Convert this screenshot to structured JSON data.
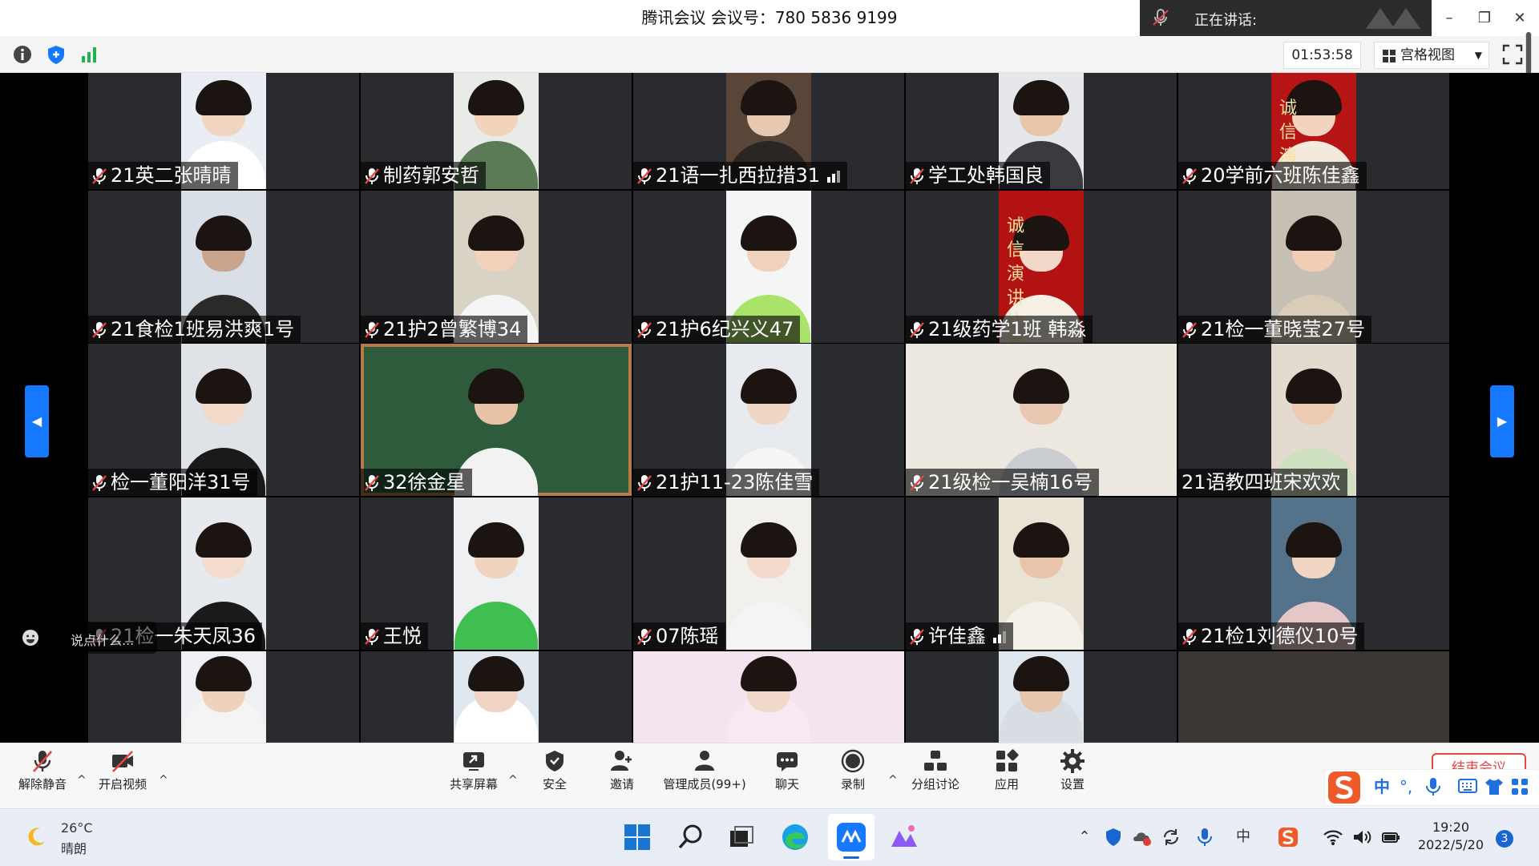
{
  "titlebar": {
    "title": "腾讯会议 会议号：780 5836 9199",
    "speaking_label": "正在讲话:",
    "minimize": "–",
    "restore": "❐",
    "close": "✕"
  },
  "toolbar2": {
    "timer": "01:53:58",
    "view_label": "宫格视图",
    "view_caret": "▼",
    "info_icon": "info-icon",
    "shield_icon": "shield-icon",
    "signal_icon": "signal-icon"
  },
  "grid": {
    "names": [
      "21英二张晴晴",
      "制药郭安哲",
      "21语一扎西拉措31",
      "学工处韩国良",
      "20学前六班陈佳鑫",
      "21食检1班易洪爽1号",
      "21护2曾繁博34",
      "21护6纪兴义47",
      "21级药学1班 韩淼",
      "21检一董晓莹27号",
      "检一董阳洋31号",
      "32徐金星",
      "21护11-23陈佳雪",
      "21级检一吴楠16号",
      "21语教四班宋欢欢",
      "21检一朱天凤36",
      "王悦",
      "07陈瑶",
      "许佳鑫",
      "21检1刘德仪10号"
    ],
    "banner_text": "诚信演讲比赛"
  },
  "chat": {
    "placeholder": "说点什么..."
  },
  "nav": {
    "prev": "◀",
    "next": "▶"
  },
  "controls": {
    "unmute": "解除静音",
    "video": "开启视频",
    "share": "共享屏幕",
    "security": "安全",
    "invite": "邀请",
    "manage": "管理成员(99+)",
    "chat": "聊天",
    "record": "录制",
    "breakout": "分组讨论",
    "apps": "应用",
    "settings": "设置",
    "end": "结束会议",
    "caret": "^"
  },
  "ime": {
    "lang": "中",
    "punct": "°,"
  },
  "taskbar": {
    "temp": "26°C",
    "weather": "晴朗",
    "time": "19:20",
    "date": "2022/5/20",
    "notifications": "3",
    "tray_lang": "中"
  },
  "colors": {
    "accent": "#1677ff",
    "end_red": "#e54545",
    "tile_bg": "#2a2b2e"
  }
}
